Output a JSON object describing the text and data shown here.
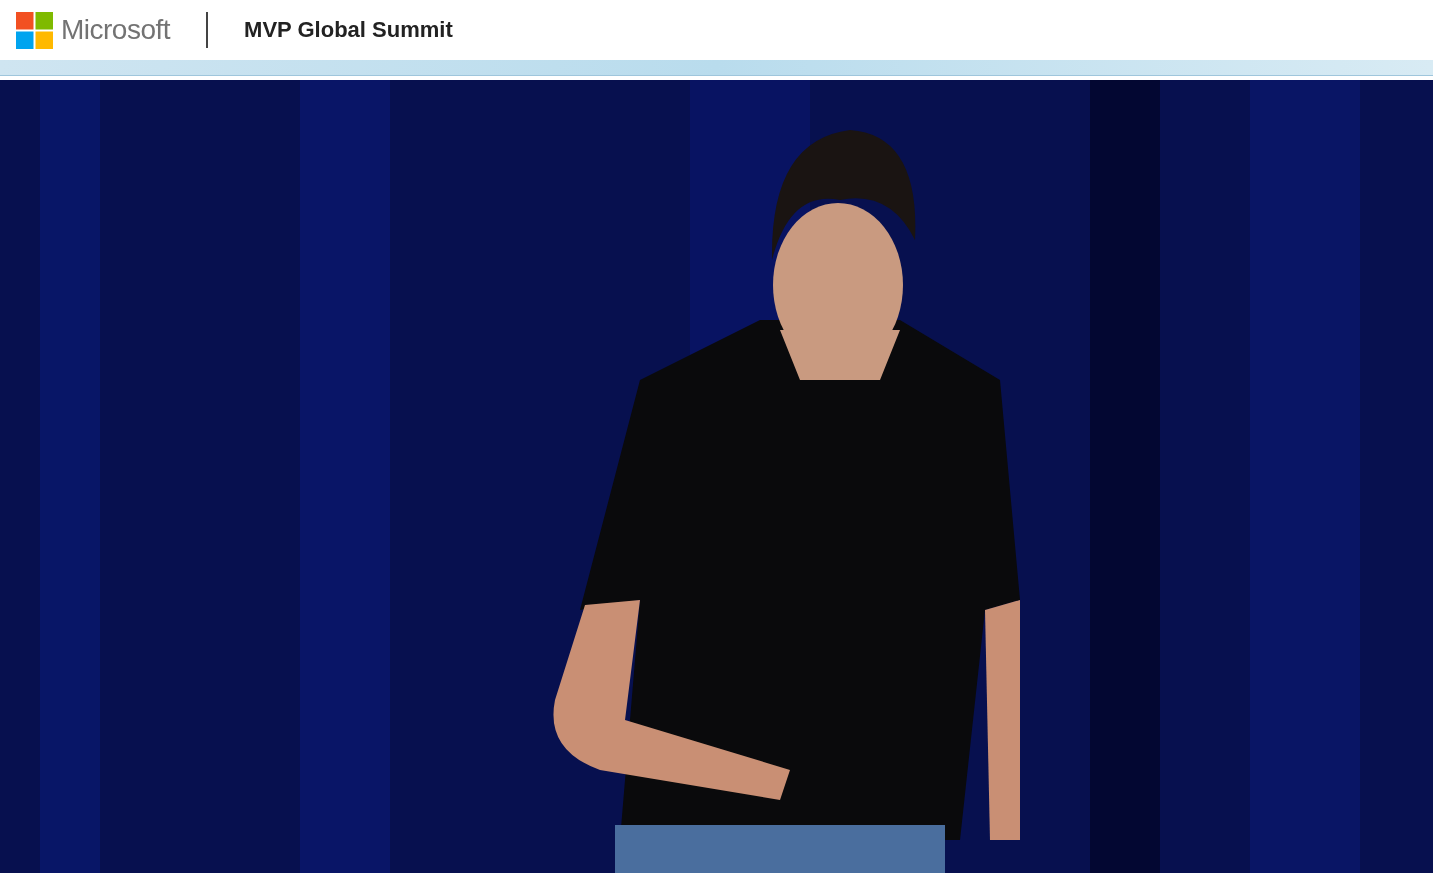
{
  "header": {
    "brand": "Microsoft",
    "title": "MVP Global Summit"
  }
}
